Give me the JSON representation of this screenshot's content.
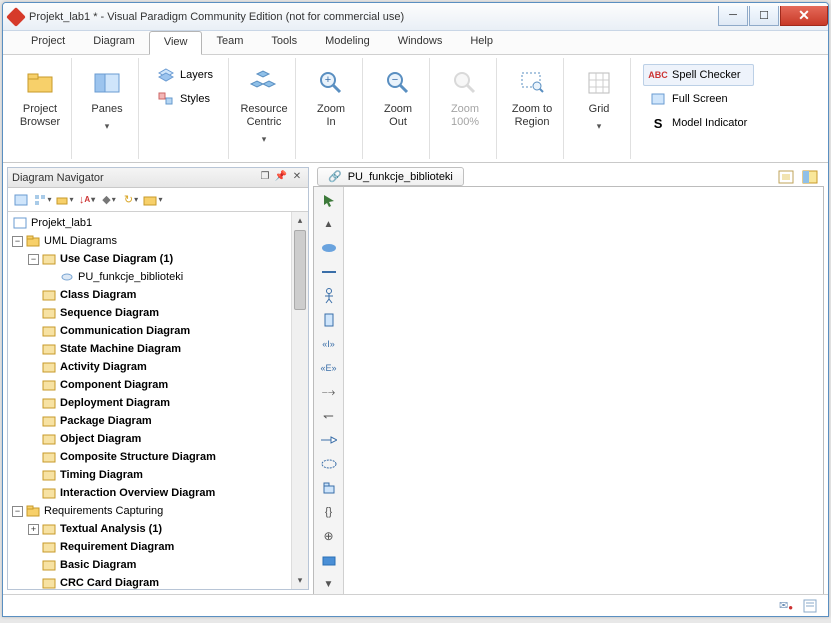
{
  "window": {
    "title": "Projekt_lab1 * - Visual Paradigm Community Edition (not for commercial use)"
  },
  "menu": {
    "items": [
      "Project",
      "Diagram",
      "View",
      "Team",
      "Tools",
      "Modeling",
      "Windows",
      "Help"
    ],
    "active": 2
  },
  "ribbon": {
    "project_browser": "Project\nBrowser",
    "panes": "Panes",
    "layers": "Layers",
    "styles": "Styles",
    "resource_centric": "Resource\nCentric",
    "zoom_in": "Zoom\nIn",
    "zoom_out": "Zoom\nOut",
    "zoom_100": "Zoom\n100%",
    "zoom_region": "Zoom to\nRegion",
    "grid": "Grid",
    "spell_checker": "Spell Checker",
    "full_screen": "Full Screen",
    "model_indicator": "Model Indicator"
  },
  "navigator": {
    "title": "Diagram Navigator",
    "root": "Projekt_lab1",
    "groups": [
      {
        "label": "UML Diagrams",
        "children": [
          {
            "label": "Use Case Diagram (1)",
            "bold": true,
            "children": [
              {
                "label": "PU_funkcje_biblioteki"
              }
            ]
          },
          {
            "label": "Class Diagram",
            "bold": true
          },
          {
            "label": "Sequence Diagram",
            "bold": true
          },
          {
            "label": "Communication Diagram",
            "bold": true
          },
          {
            "label": "State Machine Diagram",
            "bold": true
          },
          {
            "label": "Activity Diagram",
            "bold": true
          },
          {
            "label": "Component Diagram",
            "bold": true
          },
          {
            "label": "Deployment Diagram",
            "bold": true
          },
          {
            "label": "Package Diagram",
            "bold": true
          },
          {
            "label": "Object Diagram",
            "bold": true
          },
          {
            "label": "Composite Structure Diagram",
            "bold": true
          },
          {
            "label": "Timing Diagram",
            "bold": true
          },
          {
            "label": "Interaction Overview Diagram",
            "bold": true
          }
        ]
      },
      {
        "label": "Requirements Capturing",
        "children": [
          {
            "label": "Textual Analysis (1)",
            "bold": true,
            "collapsed": true
          },
          {
            "label": "Requirement Diagram",
            "bold": true
          },
          {
            "label": "Basic Diagram",
            "bold": true
          },
          {
            "label": "CRC Card Diagram",
            "bold": true
          }
        ]
      }
    ]
  },
  "doc": {
    "tab": "PU_funkcje_biblioteki"
  }
}
